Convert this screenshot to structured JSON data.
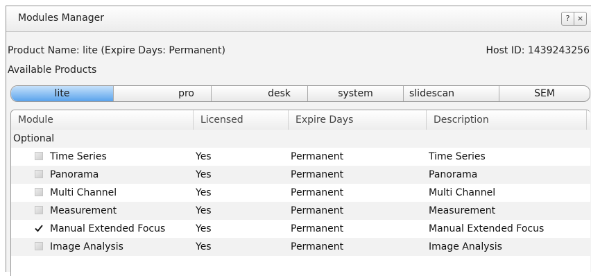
{
  "window": {
    "title": "Modules Manager",
    "help_label": "?",
    "close_label": "×"
  },
  "product": {
    "name_label": "Product Name: lite (Expire Days: Permanent)",
    "host_label": "Host ID: 1439243256",
    "available_label": "Available Products"
  },
  "tabs": [
    "lite",
    "pro",
    "desk",
    "system",
    "slidescan",
    "SEM"
  ],
  "active_tab": "lite",
  "table": {
    "columns": [
      "Module",
      "Licensed",
      "Expire Days",
      "Description"
    ],
    "group": "Optional",
    "rows": [
      {
        "checked": false,
        "module": "Time Series",
        "licensed": "Yes",
        "expire": "Permanent",
        "description": "Time Series"
      },
      {
        "checked": false,
        "module": "Panorama",
        "licensed": "Yes",
        "expire": "Permanent",
        "description": "Panorama"
      },
      {
        "checked": false,
        "module": "Multi Channel",
        "licensed": "Yes",
        "expire": "Permanent",
        "description": "Multi Channel"
      },
      {
        "checked": false,
        "module": "Measurement",
        "licensed": "Yes",
        "expire": "Permanent",
        "description": "Measurement"
      },
      {
        "checked": true,
        "module": "Manual Extended Focus",
        "licensed": "Yes",
        "expire": "Permanent",
        "description": "Manual Extended Focus"
      },
      {
        "checked": false,
        "module": "Image Analysis",
        "licensed": "Yes",
        "expire": "Permanent",
        "description": "Image Analysis"
      }
    ]
  },
  "colors": {
    "active_tab": "#5aa3ec",
    "row_alt": "#f2f2f2"
  }
}
